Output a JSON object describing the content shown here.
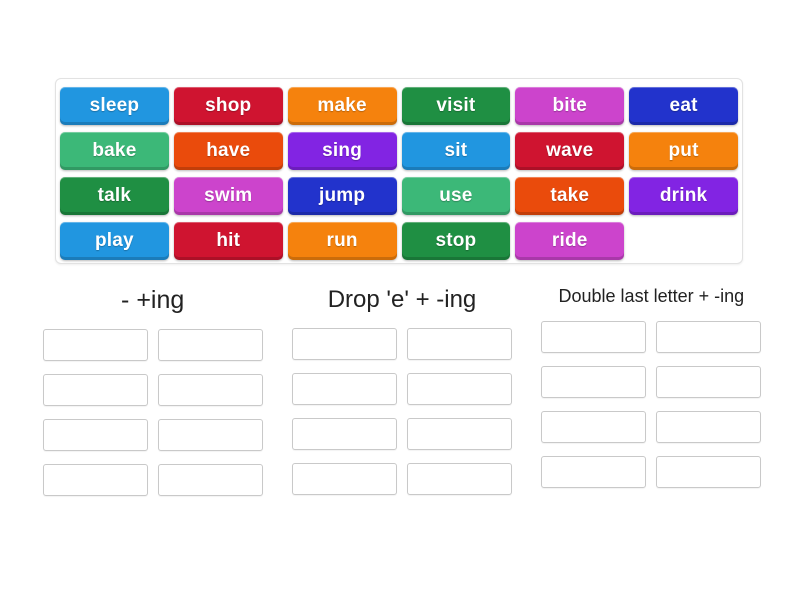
{
  "activity": {
    "type": "group-sort",
    "colors": {
      "blue": "#2196e0",
      "crimson": "#cf1430",
      "orange": "#f5820d",
      "dark_green": "#1f8f43",
      "orchid": "#d css",
      "royal_blue": "#2233cc"
    }
  },
  "word_bank": {
    "name": "verb-tiles",
    "columns": 6,
    "rows": 4,
    "tiles": [
      {
        "label": "sleep",
        "color": "#2196e0"
      },
      {
        "label": "shop",
        "color": "#cf1430"
      },
      {
        "label": "make",
        "color": "#f5820d"
      },
      {
        "label": "visit",
        "color": "#1f8f43"
      },
      {
        "label": "bite",
        "color": "#cc44cc"
      },
      {
        "label": "eat",
        "color": "#2233cc"
      },
      {
        "label": "bake",
        "color": "#3cb878"
      },
      {
        "label": "have",
        "color": "#ea4b0c"
      },
      {
        "label": "sing",
        "color": "#8224e3"
      },
      {
        "label": "sit",
        "color": "#2196e0"
      },
      {
        "label": "wave",
        "color": "#cf1430"
      },
      {
        "label": "put",
        "color": "#f5820d"
      },
      {
        "label": "talk",
        "color": "#1f8f43"
      },
      {
        "label": "swim",
        "color": "#cc44cc"
      },
      {
        "label": "jump",
        "color": "#2233cc"
      },
      {
        "label": "use",
        "color": "#3cb878"
      },
      {
        "label": "take",
        "color": "#ea4b0c"
      },
      {
        "label": "drink",
        "color": "#8224e3"
      },
      {
        "label": "play",
        "color": "#2196e0"
      },
      {
        "label": "hit",
        "color": "#cf1430"
      },
      {
        "label": "run",
        "color": "#f5820d"
      },
      {
        "label": "stop",
        "color": "#1f8f43"
      },
      {
        "label": "ride",
        "color": "#cc44cc"
      },
      {
        "label": "",
        "color": ""
      }
    ]
  },
  "categories": [
    {
      "title": "- +ing",
      "title_size": "size-lg",
      "slots": [
        "",
        "",
        "",
        "",
        "",
        "",
        "",
        ""
      ]
    },
    {
      "title": "Drop 'e' + -ing",
      "title_size": "size-md",
      "slots": [
        "",
        "",
        "",
        "",
        "",
        "",
        "",
        ""
      ]
    },
    {
      "title": "Double last letter + -ing",
      "title_size": "size-sm",
      "slots": [
        "",
        "",
        "",
        "",
        "",
        "",
        "",
        ""
      ]
    }
  ]
}
